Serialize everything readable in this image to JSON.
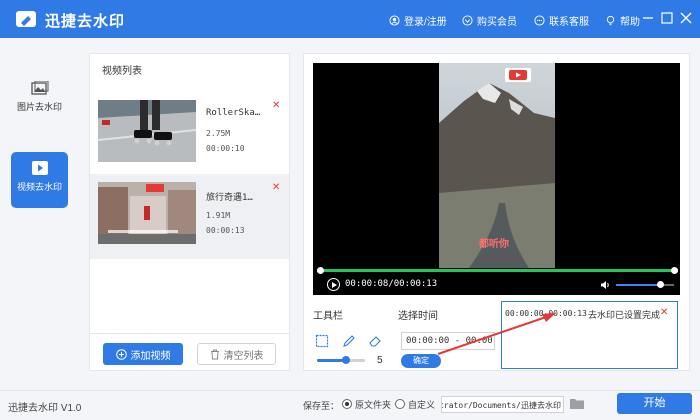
{
  "app": {
    "title": "迅捷去水印",
    "version": "迅捷去水印 V1.0"
  },
  "topbar": {
    "login": "登录/注册",
    "vip": "购买会员",
    "service": "联系客服",
    "help": "帮助"
  },
  "sidebar": {
    "items": [
      {
        "label": "图片去水印"
      },
      {
        "label": "视频去水印"
      }
    ]
  },
  "video_list": {
    "title": "视频列表",
    "items": [
      {
        "name": "RollerSka…",
        "size": "2.75M",
        "duration": "00:00:10"
      },
      {
        "name": "旅行奇遇1…",
        "size": "1.91M",
        "duration": "00:00:13"
      }
    ],
    "add_label": "添加视频",
    "clear_label": "清空列表"
  },
  "player": {
    "time": "00:00:08/00:00:13",
    "progress": 1.0,
    "volume": 0.75,
    "caption": "都听你"
  },
  "editor": {
    "toolbar_label": "工具栏",
    "select_time_label": "选择时间",
    "brush_size": "5",
    "brush_fraction": 0.6,
    "time_range": "00:00:00 - 00:00:13",
    "confirm_label": "确定",
    "watermark": {
      "time": "00:00:00-00:00:13",
      "status": "去水印已设置完成"
    }
  },
  "footer": {
    "save_to_label": "保存至：",
    "option_original": "原文件夹",
    "option_custom": "自定义",
    "path": "C:/Users/Administrator/Documents/迅捷去水印",
    "start_label": "开始"
  },
  "colors": {
    "accent": "#2f7ae5",
    "progress": "#22c55e",
    "delete": "#e53935"
  }
}
